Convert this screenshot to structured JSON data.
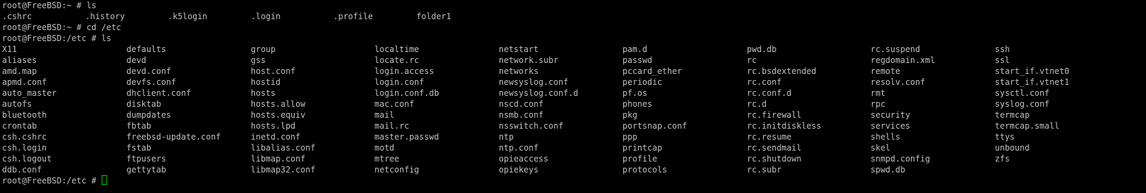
{
  "terminal": {
    "colors": {
      "background": "#000000",
      "text": "#c0c0c0",
      "cursor": "#00cc00"
    },
    "lines": [
      {
        "kind": "prompt",
        "text": "root@FreeBSD:~ # ls"
      },
      {
        "kind": "cols",
        "cells": [
          ".cshrc",
          ".history",
          ".k5login",
          ".login",
          ".profile",
          "folder1"
        ]
      },
      {
        "kind": "prompt",
        "text": "root@FreeBSD:~ # cd /etc"
      },
      {
        "kind": "prompt",
        "text": "root@FreeBSD:/etc # ls"
      },
      {
        "kind": "grid",
        "cells": [
          "X11",
          "defaults",
          "group",
          "localtime",
          "netstart",
          "pam.d",
          "pwd.db",
          "rc.suspend",
          "ssh"
        ]
      },
      {
        "kind": "grid",
        "cells": [
          "aliases",
          "devd",
          "gss",
          "locate.rc",
          "network.subr",
          "passwd",
          "rc",
          "regdomain.xml",
          "ssl"
        ]
      },
      {
        "kind": "grid",
        "cells": [
          "amd.map",
          "devd.conf",
          "host.conf",
          "login.access",
          "networks",
          "pccard_ether",
          "rc.bsdextended",
          "remote",
          "start_if.vtnet0"
        ]
      },
      {
        "kind": "grid",
        "cells": [
          "apmd.conf",
          "devfs.conf",
          "hostid",
          "login.conf",
          "newsyslog.conf",
          "periodic",
          "rc.conf",
          "resolv.conf",
          "start_if.vtnet1"
        ]
      },
      {
        "kind": "grid",
        "cells": [
          "auto_master",
          "dhclient.conf",
          "hosts",
          "login.conf.db",
          "newsyslog.conf.d",
          "pf.os",
          "rc.conf.d",
          "rmt",
          "sysctl.conf"
        ]
      },
      {
        "kind": "grid",
        "cells": [
          "autofs",
          "disktab",
          "hosts.allow",
          "mac.conf",
          "nscd.conf",
          "phones",
          "rc.d",
          "rpc",
          "syslog.conf"
        ]
      },
      {
        "kind": "grid",
        "cells": [
          "bluetooth",
          "dumpdates",
          "hosts.equiv",
          "mail",
          "nsmb.conf",
          "pkg",
          "rc.firewall",
          "security",
          "termcap"
        ]
      },
      {
        "kind": "grid",
        "cells": [
          "crontab",
          "fbtab",
          "hosts.lpd",
          "mail.rc",
          "nsswitch.conf",
          "portsnap.conf",
          "rc.initdiskless",
          "services",
          "termcap.small"
        ]
      },
      {
        "kind": "grid",
        "cells": [
          "csh.cshrc",
          "freebsd-update.conf",
          "inetd.conf",
          "master.passwd",
          "ntp",
          "ppp",
          "rc.resume",
          "shells",
          "ttys"
        ]
      },
      {
        "kind": "grid",
        "cells": [
          "csh.login",
          "fstab",
          "libalias.conf",
          "motd",
          "ntp.conf",
          "printcap",
          "rc.sendmail",
          "skel",
          "unbound"
        ]
      },
      {
        "kind": "grid",
        "cells": [
          "csh.logout",
          "ftpusers",
          "libmap.conf",
          "mtree",
          "opieaccess",
          "profile",
          "rc.shutdown",
          "snmpd.config",
          "zfs"
        ]
      },
      {
        "kind": "grid",
        "cells": [
          "ddb.conf",
          "gettytab",
          "libmap32.conf",
          "netconfig",
          "opiekeys",
          "protocols",
          "rc.subr",
          "spwd.db",
          ""
        ]
      },
      {
        "kind": "cursor-prompt",
        "text": "root@FreeBSD:/etc # "
      }
    ]
  }
}
